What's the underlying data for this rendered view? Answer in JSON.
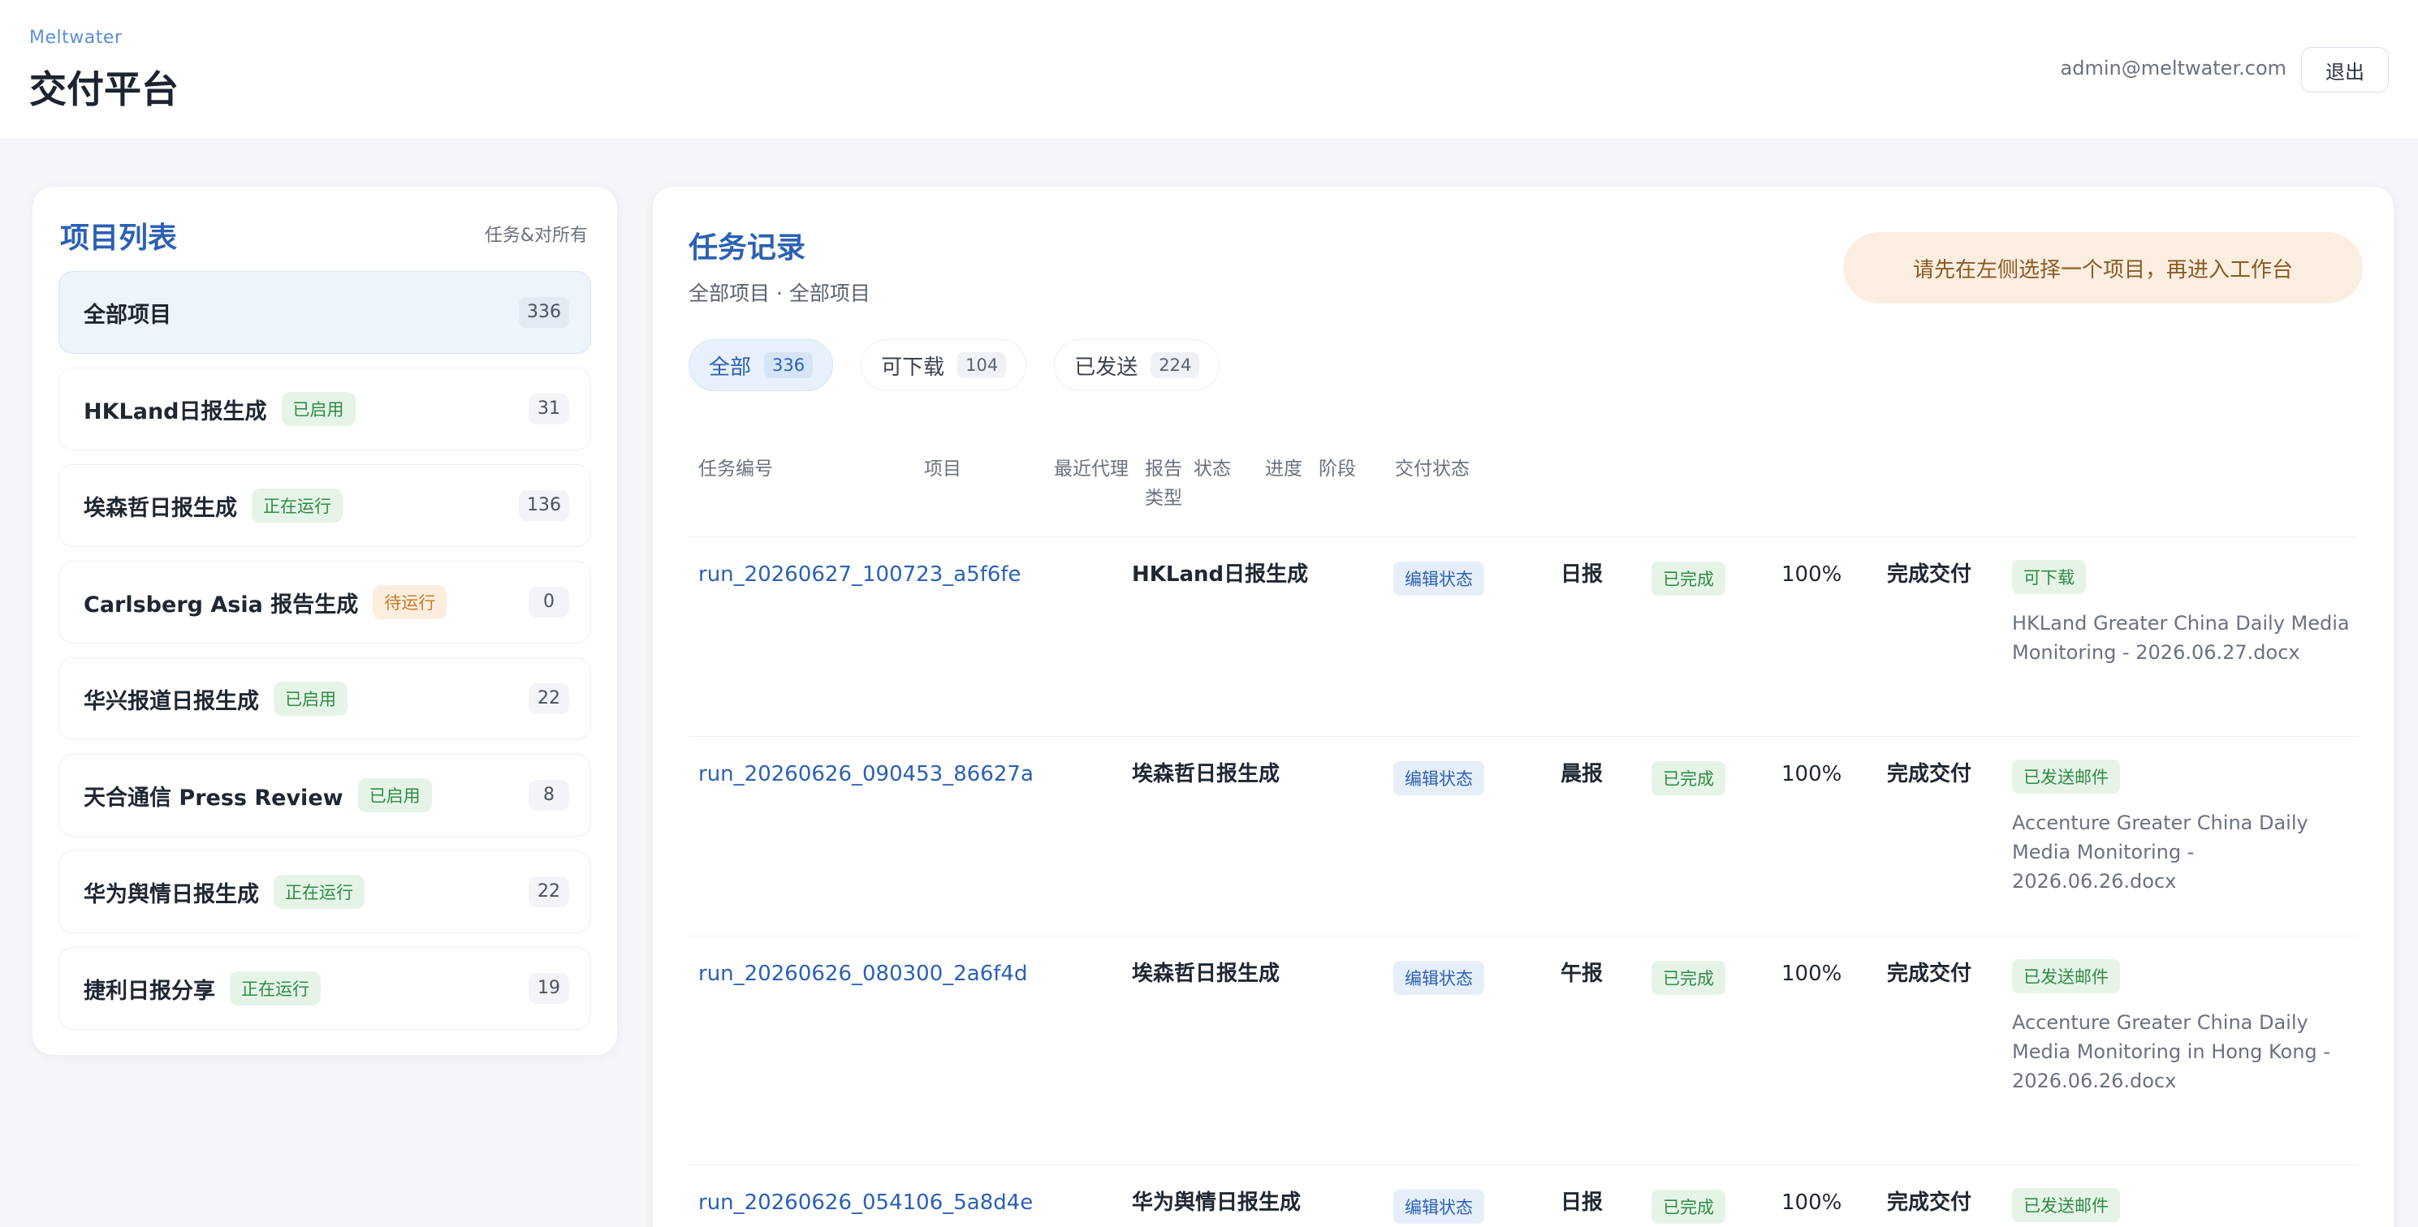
{
  "header": {
    "subtitle": "Meltwater",
    "title": "交付平台",
    "user_email": "admin@meltwater.com",
    "logout_label": "退出"
  },
  "projects_panel": {
    "title": "项目列表",
    "hint": "任务&对所有",
    "items": [
      {
        "name": "全部项目",
        "tag": "",
        "count": "336",
        "active": true
      },
      {
        "name": "HKLand日报生成",
        "tag": "已启用",
        "tag_color": "green",
        "count": "31"
      },
      {
        "name": "埃森哲日报生成",
        "tag": "正在运行",
        "tag_color": "green",
        "count": "136"
      },
      {
        "name": "Carlsberg Asia 报告生成",
        "tag": "待运行",
        "tag_color": "orange",
        "count": "0"
      },
      {
        "name": "华兴报道日报生成",
        "tag": "已启用",
        "tag_color": "green",
        "count": "22"
      },
      {
        "name": "天合通信 Press Review",
        "tag": "已启用",
        "tag_color": "green",
        "count": "8"
      },
      {
        "name": "华为舆情日报生成",
        "tag": "正在运行",
        "tag_color": "green",
        "count": "22"
      },
      {
        "name": "捷利日报分享",
        "tag": "正在运行",
        "tag_color": "green",
        "count": "19"
      }
    ]
  },
  "tasks_panel": {
    "title": "任务记录",
    "breadcrumb": "全部项目 · 全部项目",
    "notice": "请先在左侧选择一个项目，再进入工作台",
    "filters": [
      {
        "label": "全部",
        "count": "336",
        "active": true
      },
      {
        "label": "可下载",
        "count": "104"
      },
      {
        "label": "已发送",
        "count": "224"
      }
    ],
    "columns": [
      "任务编号",
      "项目",
      "最近代理",
      "报告类型",
      "状态",
      "进度",
      "阶段",
      "交付状态"
    ],
    "rows": [
      {
        "run_id": "run_20260627_100723_a5f6fe",
        "project": "HKLand日报生成",
        "agent": "编辑状态",
        "report_type": "日报",
        "status": "已完成",
        "progress": "100%",
        "stage": "完成交付",
        "delivery_badge": "可下载",
        "delivery_file": "HKLand Greater China Daily Media Monitoring - 2026.06.27.docx"
      },
      {
        "run_id": "run_20260626_090453_86627a",
        "project": "埃森哲日报生成",
        "agent": "编辑状态",
        "report_type": "晨报",
        "status": "已完成",
        "progress": "100%",
        "stage": "完成交付",
        "delivery_badge": "已发送邮件",
        "delivery_file": "Accenture Greater China Daily Media Monitoring - 2026.06.26.docx"
      },
      {
        "run_id": "run_20260626_080300_2a6f4d",
        "project": "埃森哲日报生成",
        "agent": "编辑状态",
        "report_type": "午报",
        "status": "已完成",
        "progress": "100%",
        "stage": "完成交付",
        "delivery_badge": "已发送邮件",
        "delivery_file": "Accenture Greater China Daily Media Monitoring in Hong Kong - 2026.06.26.docx"
      },
      {
        "run_id": "run_20260626_054106_5a8d4e",
        "project": "华为舆情日报生成",
        "agent": "编辑状态",
        "report_type": "日报",
        "status": "已完成",
        "progress": "100%",
        "stage": "完成交付",
        "delivery_badge": "已发送邮件",
        "delivery_file": ""
      }
    ]
  },
  "colors": {
    "accent": "#2b61b4",
    "success_bg": "#e6f4e8",
    "success_text": "#2f8a45",
    "warning_bg": "#fbeee0",
    "warning_text": "#8a5a24"
  }
}
